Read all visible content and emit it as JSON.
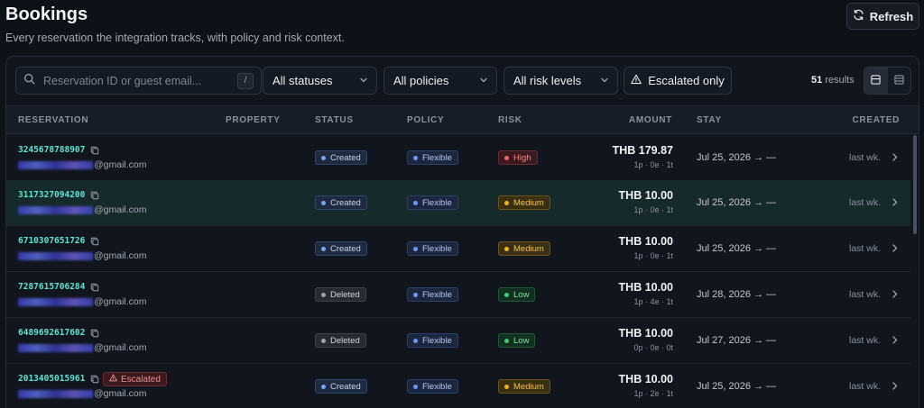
{
  "header": {
    "title": "Bookings",
    "subtitle": "Every reservation the integration tracks, with policy and risk context.",
    "refresh_label": "Refresh"
  },
  "toolbar": {
    "search_placeholder": "Reservation ID or guest email...",
    "search_shortcut": "/",
    "filters": {
      "status": "All statuses",
      "policy": "All policies",
      "risk": "All risk levels"
    },
    "escalated_label": "Escalated only",
    "results_count": "51",
    "results_label": "results"
  },
  "table": {
    "columns": {
      "reservation": "RESERVATION",
      "property": "PROPERTY",
      "status": "STATUS",
      "policy": "POLICY",
      "risk": "RISK",
      "amount": "AMOUNT",
      "stay": "STAY",
      "created": "CREATED"
    },
    "rows": [
      {
        "id": "3245678788907",
        "email_domain": "@gmail.com",
        "escalated": "",
        "status": "Created",
        "policy": "Flexible",
        "risk": "High",
        "amount": "THB 179.87",
        "guests": "1p · 0e · 1t",
        "stay": "Jul 25, 2026 → —",
        "created": "last wk."
      },
      {
        "id": "3117327094200",
        "email_domain": "@gmail.com",
        "escalated": "",
        "status": "Created",
        "policy": "Flexible",
        "risk": "Medium",
        "amount": "THB 10.00",
        "guests": "1p · 0e · 1t",
        "stay": "Jul 25, 2026 → —",
        "created": "last wk."
      },
      {
        "id": "6710307651726",
        "email_domain": "@gmail.com",
        "escalated": "",
        "status": "Created",
        "policy": "Flexible",
        "risk": "Medium",
        "amount": "THB 10.00",
        "guests": "1p · 0e · 1t",
        "stay": "Jul 25, 2026 → —",
        "created": "last wk."
      },
      {
        "id": "7287615706284",
        "email_domain": "@gmail.com",
        "escalated": "",
        "status": "Deleted",
        "policy": "Flexible",
        "risk": "Low",
        "amount": "THB 10.00",
        "guests": "1p · 4e · 1t",
        "stay": "Jul 28, 2026 → —",
        "created": "last wk."
      },
      {
        "id": "6489692617602",
        "email_domain": "@gmail.com",
        "escalated": "",
        "status": "Deleted",
        "policy": "Flexible",
        "risk": "Low",
        "amount": "THB 10.00",
        "guests": "0p · 0e · 0t",
        "stay": "Jul 27, 2026 → —",
        "created": "last wk."
      },
      {
        "id": "2013405015961",
        "email_domain": "@gmail.com",
        "escalated": "Escalated",
        "status": "Created",
        "policy": "Flexible",
        "risk": "Medium",
        "amount": "THB 10.00",
        "guests": "1p · 2e · 1t",
        "stay": "Jul 25, 2026 → —",
        "created": "last wk."
      }
    ]
  },
  "colors": {
    "background": "#0d1118",
    "accent_id": "#5fe3d2",
    "risk_high": "#f06767",
    "risk_medium": "#f2b21d",
    "risk_low": "#3fce78",
    "highlight_row": "#16292b"
  },
  "icons": {
    "refresh": "refresh-icon",
    "search": "search-icon",
    "chevron": "chevron-down-icon",
    "warning": "warning-icon",
    "copy": "copy-icon",
    "row_chevron": "chevron-right-icon",
    "view_table": "table-view-icon",
    "view_list": "list-view-icon"
  }
}
